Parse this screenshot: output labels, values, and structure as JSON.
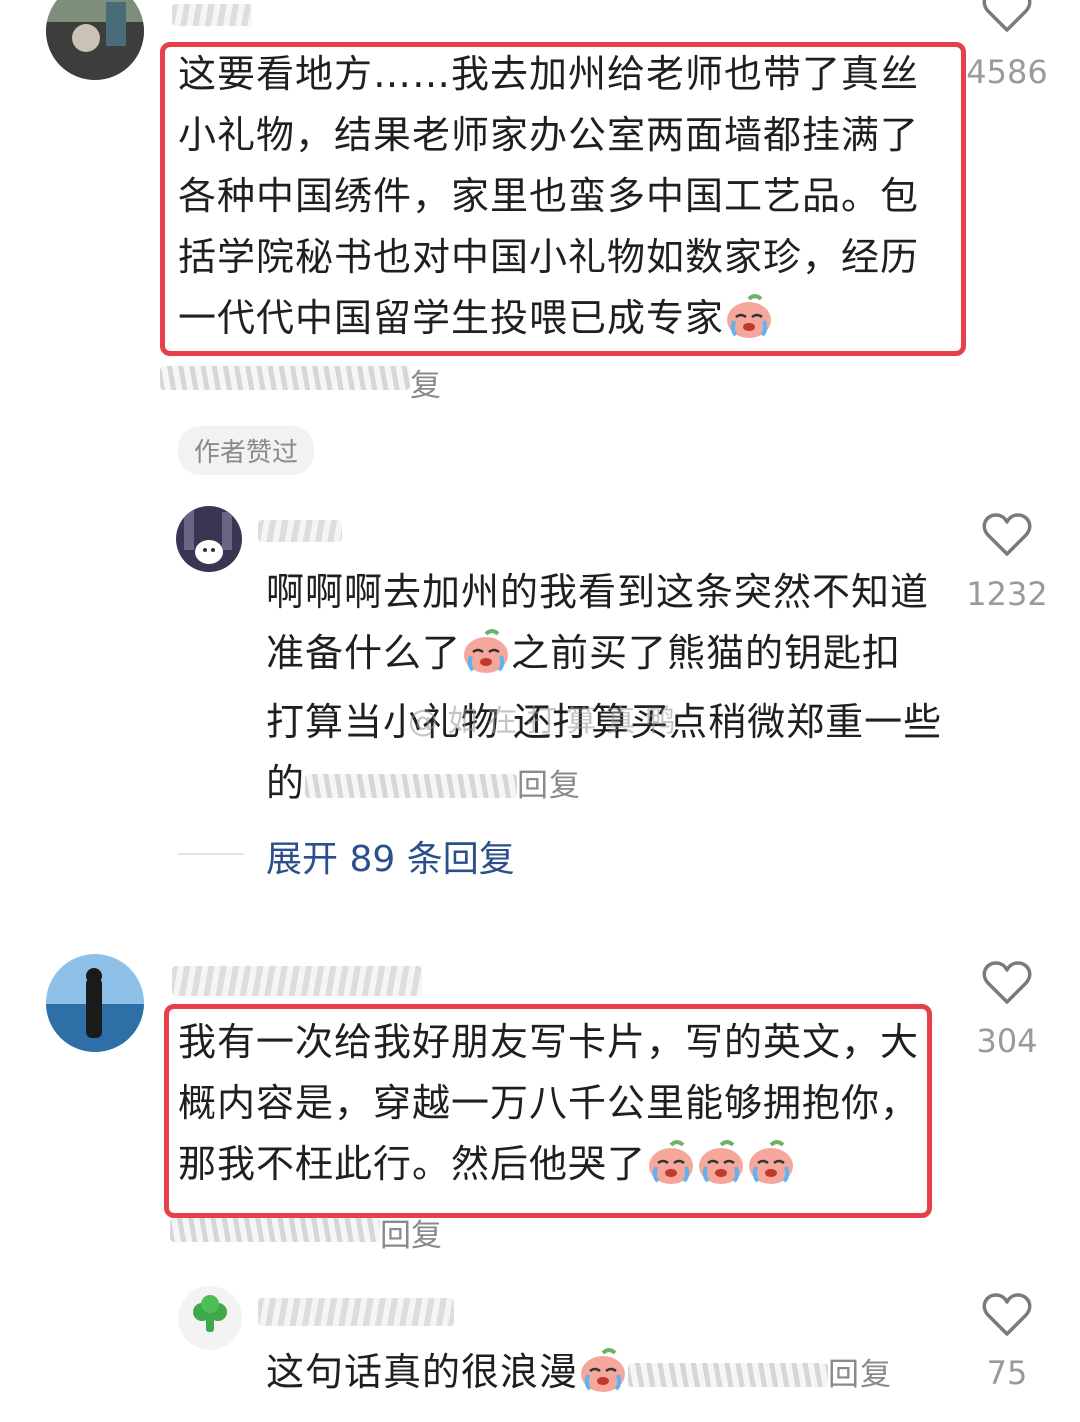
{
  "comments": [
    {
      "text": "这要看地方……我去加州给老师也带了真丝小礼物，结果老师家办公室两面墙都挂满了各种中国绣件，家里也蛮多中国工艺品。包括学院秘书也对中国小礼物如数家珍，经历一代代中国留学生投喂已成专家",
      "lines": [
        "这要看地方……我去加州给老师也带了真丝",
        "小礼物，结果老师家办公室两面墙都挂满了",
        "各种中国绣件，家里也蛮多中国工艺品。包",
        "括学院秘书也对中国小礼物如数家珍，经历",
        "一代代中国留学生投喂已成专家"
      ],
      "reply_label": "复",
      "like_count": "4586",
      "author_badge": "作者赞过"
    },
    {
      "lines": [
        "啊啊啊去加州的我看到这条突然不知道",
        "准备什么了",
        "之前买了熊猫的钥匙扣",
        "打算当小礼物 还打算买点稍微郑重一些",
        "的"
      ],
      "reply_label": "回复",
      "like_count": "1232",
      "expand_label": "展开 89 条回复"
    },
    {
      "lines": [
        "我有一次给我好朋友写卡片，写的英文，大",
        "概内容是，穿越一万八千公里能够拥抱你，",
        "那我不枉此行。然后他哭了"
      ],
      "reply_label": "回复",
      "like_count": "304"
    },
    {
      "line": "这句话真的很浪漫",
      "reply_label": "回复",
      "like_count": "75"
    }
  ],
  "watermark": "@ 如 在 打 算 真 鸭",
  "icons": {
    "like": "heart-outline-icon",
    "emoji": "crying-peach-emoji-icon"
  },
  "colors": {
    "highlight": "#e8404a",
    "expand_link": "#2a4f8a",
    "muted": "#8a8a8a"
  }
}
